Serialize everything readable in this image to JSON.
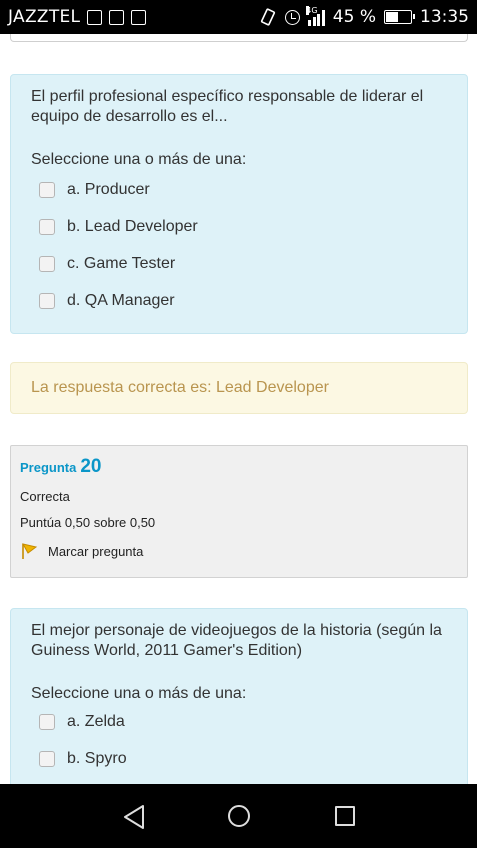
{
  "statusbar": {
    "carrier": "JAZZTEL",
    "network": "4G",
    "battery": "45 %",
    "battery_level": 0.45,
    "time": "13:35"
  },
  "question1": {
    "text": "El perfil profesional específico responsable de liderar el equipo de desarrollo es el...",
    "prompt": "Seleccione una o más de una:",
    "options": [
      "a. Producer",
      "b. Lead Developer",
      "c. Game Tester",
      "d. QA Manager"
    ]
  },
  "feedback": {
    "text": "La respuesta correcta es: Lead Developer"
  },
  "info": {
    "label": "Pregunta",
    "number": "20",
    "status": "Correcta",
    "score": "Puntúa 0,50 sobre 0,50",
    "flag_label": "Marcar pregunta"
  },
  "question2": {
    "text": "El mejor personaje de videojuegos de la historia (según la Guiness World, 2011 Gamer's Edition)",
    "prompt": "Seleccione una o más de una:",
    "options": [
      "a. Zelda",
      "b. Spyro"
    ]
  },
  "icons": {
    "status_left": [
      "image-icon",
      "mail-icon",
      "keyboard-icon"
    ],
    "status_right": [
      "vibrate-icon",
      "alarm-icon",
      "signal-icon",
      "battery-icon"
    ],
    "flag": "flag-icon",
    "nav": [
      "back-icon",
      "home-icon",
      "recent-apps-icon"
    ]
  },
  "colors": {
    "question_bg": "#def2f8",
    "feedback_bg": "#fcf8e3",
    "feedback_text": "#b9954f",
    "accent": "#0b96c8",
    "flag": "#f0b400"
  }
}
